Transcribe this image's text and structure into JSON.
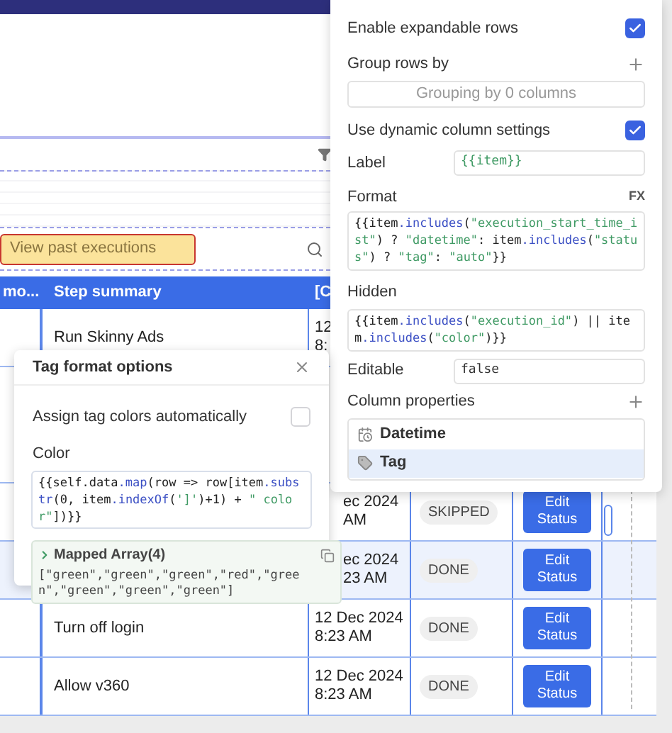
{
  "toolbar": {
    "button": "View past executions"
  },
  "table": {
    "columns": [
      "mo...",
      "Step summary",
      "[C"
    ],
    "rows": [
      {
        "kind": "plain",
        "selected": false,
        "cells": [
          "",
          "Run Skinny Ads"
        ],
        "date": [
          "12",
          "8:"
        ]
      },
      {
        "kind": "under-popup",
        "selected": false,
        "cells": [
          "",
          ""
        ],
        "date": [
          "ec 2024",
          "AM"
        ],
        "status": "SKIPPED",
        "action": "Edit Status"
      },
      {
        "kind": "under-popup",
        "selected": true,
        "cells": [
          "",
          ""
        ],
        "date": [
          "ec 2024",
          "23 AM"
        ],
        "status": "DONE",
        "action": "Edit Status"
      },
      {
        "kind": "plain",
        "selected": false,
        "cells": [
          "",
          "Turn off login"
        ],
        "date": [
          "12 Dec 2024",
          "8:23 AM"
        ],
        "status": "DONE",
        "action": "Edit Status"
      },
      {
        "kind": "plain",
        "selected": false,
        "cells": [
          "",
          "Allow v360"
        ],
        "date": [
          "12 Dec 2024",
          "8:23 AM"
        ],
        "status": "DONE",
        "action": "Edit Status"
      }
    ]
  },
  "inspector": {
    "expandable": {
      "label": "Enable expandable rows",
      "checked": true
    },
    "group": {
      "label": "Group rows by",
      "placeholder": "Grouping by 0 columns"
    },
    "dynamic": {
      "label": "Use dynamic column settings",
      "checked": true
    },
    "label_field": {
      "label": "Label",
      "value": "{{item}}"
    },
    "format": {
      "label": "Format",
      "badge": "FX",
      "value": "{{item.includes(\"execution_start_time_ist\") ? \"datetime\": item.includes(\"status\") ? \"tag\": \"auto\"}}"
    },
    "hidden": {
      "label": "Hidden",
      "value": "{{item.includes(\"execution_id\") || item.includes(\"color\")}}"
    },
    "editable": {
      "label": "Editable",
      "value": "false"
    },
    "column_properties": {
      "label": "Column properties",
      "items": [
        {
          "kind": "calendar",
          "label": "Datetime",
          "selected": false
        },
        {
          "kind": "tag",
          "label": "Tag",
          "selected": true
        }
      ]
    }
  },
  "popup": {
    "title": "Tag format options",
    "auto_colors": {
      "label": "Assign tag colors automatically",
      "checked": false
    },
    "color": {
      "label": "Color",
      "value": "{{self.data.map(row => row[item.substr(0, item.indexOf(']')+1) + \" color\"])}}"
    },
    "preview": {
      "title": "Mapped Array(4)",
      "value": "[\"green\",\"green\",\"green\",\"red\",\"green\",\"green\",\"green\",\"green\"]"
    }
  }
}
